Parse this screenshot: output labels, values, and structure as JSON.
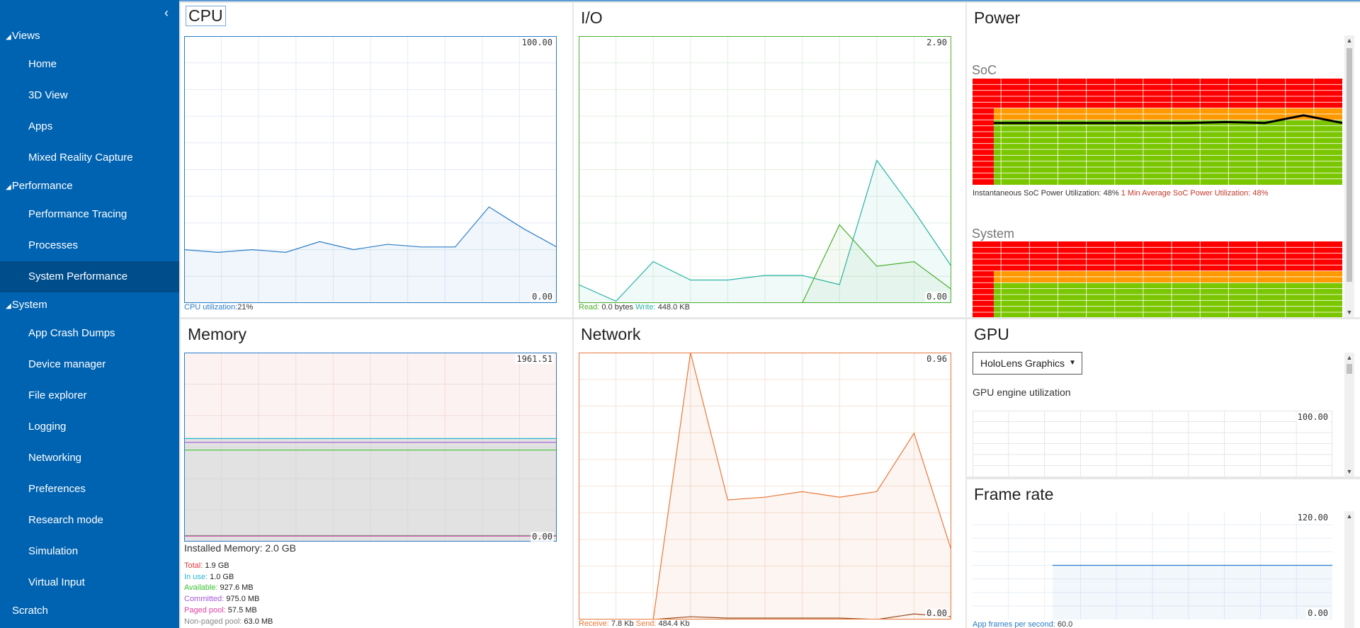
{
  "sidebar": {
    "sections": [
      {
        "title": "Views",
        "items": [
          "Home",
          "3D View",
          "Apps",
          "Mixed Reality Capture"
        ]
      },
      {
        "title": "Performance",
        "items": [
          "Performance Tracing",
          "Processes",
          "System Performance"
        ]
      },
      {
        "title": "System",
        "items": [
          "App Crash Dumps",
          "Device manager",
          "File explorer",
          "Logging",
          "Networking",
          "Preferences",
          "Research mode",
          "Simulation",
          "Virtual Input"
        ]
      }
    ],
    "bottom_item": "Scratch",
    "active_item": "System Performance"
  },
  "cpu": {
    "title": "CPU",
    "max_label": "100.00",
    "min_label": "0.00",
    "legend": {
      "label": "CPU utilization:",
      "value": "21%"
    }
  },
  "io": {
    "title": "I/O",
    "max_label": "2.90",
    "min_label": "0.00",
    "legend": {
      "read_label": "Read:",
      "read_value": "0.0 bytes",
      "write_label": "Write:",
      "write_value": "448.0 KB"
    }
  },
  "power": {
    "title": "Power",
    "soc_label": "SoC",
    "system_label": "System",
    "soc_caption": "Instantaneous SoC Power Utilization: 48%",
    "soc_avg_caption": "1 Min Average SoC Power Utilization: 48%"
  },
  "memory": {
    "title": "Memory",
    "max_label": "1961.51",
    "min_label": "0.00",
    "installed": "Installed Memory: 2.0 GB",
    "stats": [
      {
        "label": "Total:",
        "value": "1.9 GB",
        "color": "#e0393e"
      },
      {
        "label": "In use:",
        "value": "1.0 GB",
        "color": "#27b6d6"
      },
      {
        "label": "Available:",
        "value": "927.6 MB",
        "color": "#36c22e"
      },
      {
        "label": "Committed:",
        "value": "975.0 MB",
        "color": "#a259d9"
      },
      {
        "label": "Paged pool:",
        "value": "57.5 MB",
        "color": "#e23fa3"
      },
      {
        "label": "Non-paged pool:",
        "value": "63.0 MB",
        "color": "#888888"
      }
    ]
  },
  "network": {
    "title": "Network",
    "max_label": "0.96",
    "min_label": "0.00",
    "legend": {
      "receive_label": "Receive:",
      "receive_value": "7.8 Kb",
      "send_label": "Send:",
      "send_value": "484.4 Kb"
    }
  },
  "gpu": {
    "title": "GPU",
    "selected_adapter": "HoloLens Graphics",
    "engine_label": "GPU engine utilization",
    "max_label": "100.00"
  },
  "framerate": {
    "title": "Frame rate",
    "max_label": "120.00",
    "min_label": "0.00",
    "legend": {
      "label": "App frames per second:",
      "value": "60.0"
    }
  },
  "colors": {
    "sidebar_bg": "#0063b1",
    "sidebar_active": "#004d8c",
    "cpu": "#2a7cc7",
    "io_read": "#4caf2f",
    "io_write": "#2ab3a6",
    "network": "#e8783a",
    "network_dark": "#9a4a1e",
    "power_red": "#ff0000",
    "power_orange": "#ff9900",
    "power_green": "#7ac600"
  },
  "chart_data": [
    {
      "type": "area",
      "name": "cpu",
      "ylim": [
        0,
        100
      ],
      "series": [
        {
          "name": "CPU utilization",
          "values": [
            20,
            19,
            20,
            19,
            23,
            20,
            22,
            21,
            21,
            36,
            28,
            21
          ]
        }
      ]
    },
    {
      "type": "line",
      "name": "io",
      "ylim": [
        0,
        2.9
      ],
      "series": [
        {
          "name": "Read",
          "values": [
            null,
            null,
            null,
            null,
            null,
            null,
            0,
            0.85,
            0.4,
            0.45,
            0.15
          ]
        },
        {
          "name": "Write",
          "values": [
            0.2,
            0.02,
            0.45,
            0.25,
            0.25,
            0.3,
            0.3,
            0.2,
            1.55,
            1.0,
            0.4
          ]
        }
      ]
    },
    {
      "type": "line",
      "name": "memory",
      "ylim": [
        0,
        1961.51
      ],
      "series": [
        {
          "name": "Total",
          "values": [
            1961.51,
            1961.51
          ]
        },
        {
          "name": "In use",
          "values": [
            1070,
            1070
          ]
        },
        {
          "name": "Available",
          "values": [
            950,
            950
          ]
        },
        {
          "name": "Committed",
          "values": [
            1030,
            1030
          ]
        },
        {
          "name": "Paged pool",
          "values": [
            58,
            58
          ]
        },
        {
          "name": "Non-paged pool",
          "values": [
            63,
            63
          ]
        }
      ]
    },
    {
      "type": "area",
      "name": "network",
      "ylim": [
        0,
        0.96
      ],
      "series": [
        {
          "name": "Send",
          "values": [
            0,
            0,
            0,
            0.96,
            0.43,
            0.44,
            0.46,
            0.44,
            0.46,
            0.67,
            0.25
          ]
        },
        {
          "name": "Receive",
          "values": [
            0,
            0,
            0,
            0.01,
            0.005,
            0.005,
            0.005,
            0.005,
            0.0,
            0.02,
            0.01
          ]
        }
      ]
    },
    {
      "type": "line",
      "name": "power-soc",
      "ylim": [
        0,
        100
      ],
      "series": [
        {
          "name": "SoC Power Utilization",
          "values": [
            48,
            48,
            48,
            48,
            48,
            48,
            49,
            48,
            56,
            48
          ]
        }
      ]
    },
    {
      "type": "line",
      "name": "framerate",
      "ylim": [
        0,
        120
      ],
      "series": [
        {
          "name": "App frames per second",
          "values": [
            null,
            null,
            60,
            60,
            60,
            60,
            60,
            60,
            60,
            60
          ]
        }
      ]
    }
  ]
}
